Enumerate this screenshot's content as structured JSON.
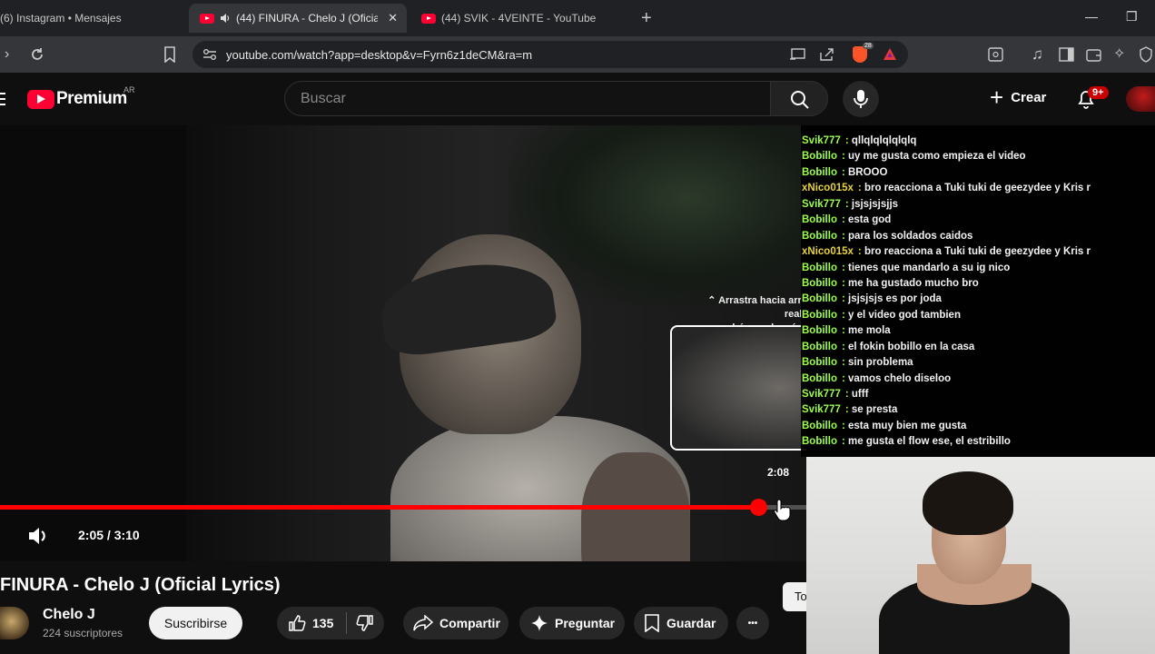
{
  "browser": {
    "tabs": [
      {
        "title": "(6) Instagram • Mensajes",
        "active": false
      },
      {
        "title": "(44) FINURA - Chelo J (Oficial",
        "active": true,
        "playing_audio": true
      },
      {
        "title": "(44) SVIK - 4VEINTE - YouTube",
        "active": false
      }
    ],
    "new_tab": "+",
    "url": "youtube.com/watch?app=desktop&v=Fyrn6z1deCM&ra=m",
    "extension_badge": "28"
  },
  "youtube": {
    "logo_text": "Premium",
    "country_code": "AR",
    "search_placeholder": "Buscar",
    "create_label": "Crear",
    "notification_count": "9+"
  },
  "player": {
    "drag_hint_line1": "Arrastra hacia arriba para realizar una",
    "drag_hint_line2": "búsqueda más precisa",
    "preview_time": "2:08",
    "current_time": "2:05",
    "duration": "3:10",
    "time_display": "2:05 / 3:10",
    "progress_fraction": 0.94
  },
  "chat": {
    "user_colors": {
      "Svik777": "#9cff4a",
      "Bobillo": "#9cff4a",
      "xNico015x": "#e8d33a"
    },
    "messages": [
      {
        "user": "Svik777",
        "text": "qllqlqlqlqlqlq"
      },
      {
        "user": "Bobillo",
        "text": "uy me gusta como empieza el video"
      },
      {
        "user": "Bobillo",
        "text": "BROOO"
      },
      {
        "user": "xNico015x",
        "text": "bro reacciona a Tuki tuki de geezydee y Kris r"
      },
      {
        "user": "Svik777",
        "text": "jsjsjsjsjjs"
      },
      {
        "user": "Bobillo",
        "text": "esta god"
      },
      {
        "user": "Bobillo",
        "text": "para los soldados caidos"
      },
      {
        "user": "xNico015x",
        "text": "bro reacciona a Tuki tuki de geezydee y Kris r"
      },
      {
        "user": "Bobillo",
        "text": "tienes que mandarlo a su ig nico"
      },
      {
        "user": "Bobillo",
        "text": "me ha gustado mucho bro"
      },
      {
        "user": "Bobillo",
        "text": "jsjsjsjs es por joda"
      },
      {
        "user": "Bobillo",
        "text": "y el video god tambien"
      },
      {
        "user": "Bobillo",
        "text": "me mola"
      },
      {
        "user": "Bobillo",
        "text": "el fokin bobillo en la casa"
      },
      {
        "user": "Bobillo",
        "text": "sin problema"
      },
      {
        "user": "Bobillo",
        "text": "vamos chelo diseloo"
      },
      {
        "user": "Svik777",
        "text": "ufff"
      },
      {
        "user": "Svik777",
        "text": "se presta"
      },
      {
        "user": "Bobillo",
        "text": "esta muy bien me gusta"
      },
      {
        "user": "Bobillo",
        "text": "me gusta el flow ese, el estribillo"
      }
    ]
  },
  "video_info": {
    "title": "FINURA - Chelo J (Oficial Lyrics)",
    "channel_name": "Chelo J",
    "subscribers": "224 suscriptores",
    "subscribe_label": "Suscribirse",
    "likes": "135",
    "share_label": "Compartir",
    "ask_label": "Preguntar",
    "save_label": "Guardar",
    "more_label": "•••",
    "partial_button": "To"
  },
  "colors": {
    "accent_red": "#ff0000",
    "youtube_red": "#ff0033",
    "background": "#0f0f0f",
    "pill": "#272727"
  }
}
